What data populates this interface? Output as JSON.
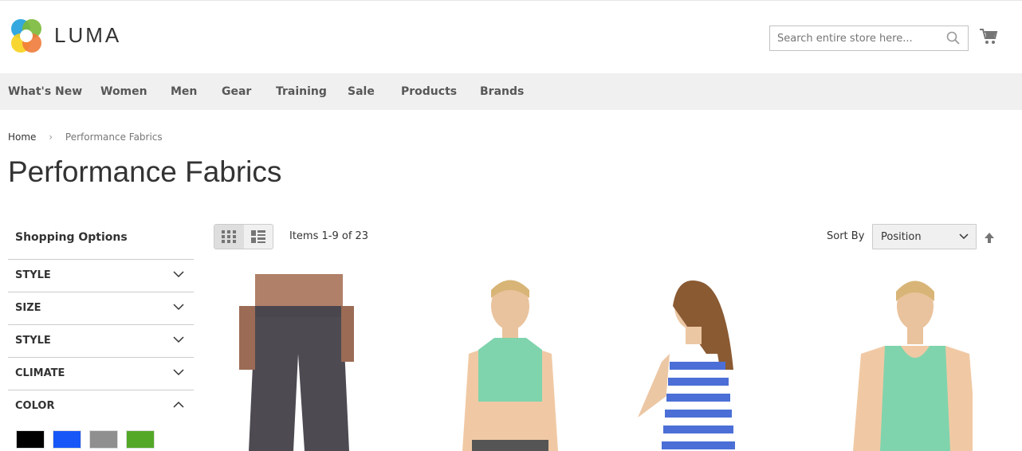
{
  "header": {
    "logo_text": "LUMA",
    "search_placeholder": "Search entire store here...",
    "icons": [
      "search-icon",
      "cart-icon"
    ]
  },
  "nav": [
    "What's New",
    "Women",
    "Men",
    "Gear",
    "Training",
    "Sale",
    "Products",
    "Brands"
  ],
  "breadcrumb": {
    "home": "Home",
    "separator": "›",
    "current": "Performance Fabrics"
  },
  "page_title": "Performance Fabrics",
  "sidebar": {
    "title": "Shopping Options",
    "filters": [
      {
        "label": "STYLE",
        "expanded": false
      },
      {
        "label": "SIZE",
        "expanded": false
      },
      {
        "label": "STYLE",
        "expanded": false
      },
      {
        "label": "CLIMATE",
        "expanded": false
      },
      {
        "label": "COLOR",
        "expanded": true
      }
    ],
    "color_swatches": [
      "#000000",
      "#1857f7",
      "#8f8f8f",
      "#53a828"
    ]
  },
  "toolbar": {
    "mode_grid": "grid",
    "mode_list": "list",
    "items_text": "Items 1-9 of 23",
    "sort_label": "Sort By",
    "sort_value": "Position"
  },
  "products": [
    {
      "image": "dark gray pants"
    },
    {
      "image": "mint sports bra"
    },
    {
      "image": "blue striped tank"
    },
    {
      "image": "mint tank top"
    }
  ]
}
